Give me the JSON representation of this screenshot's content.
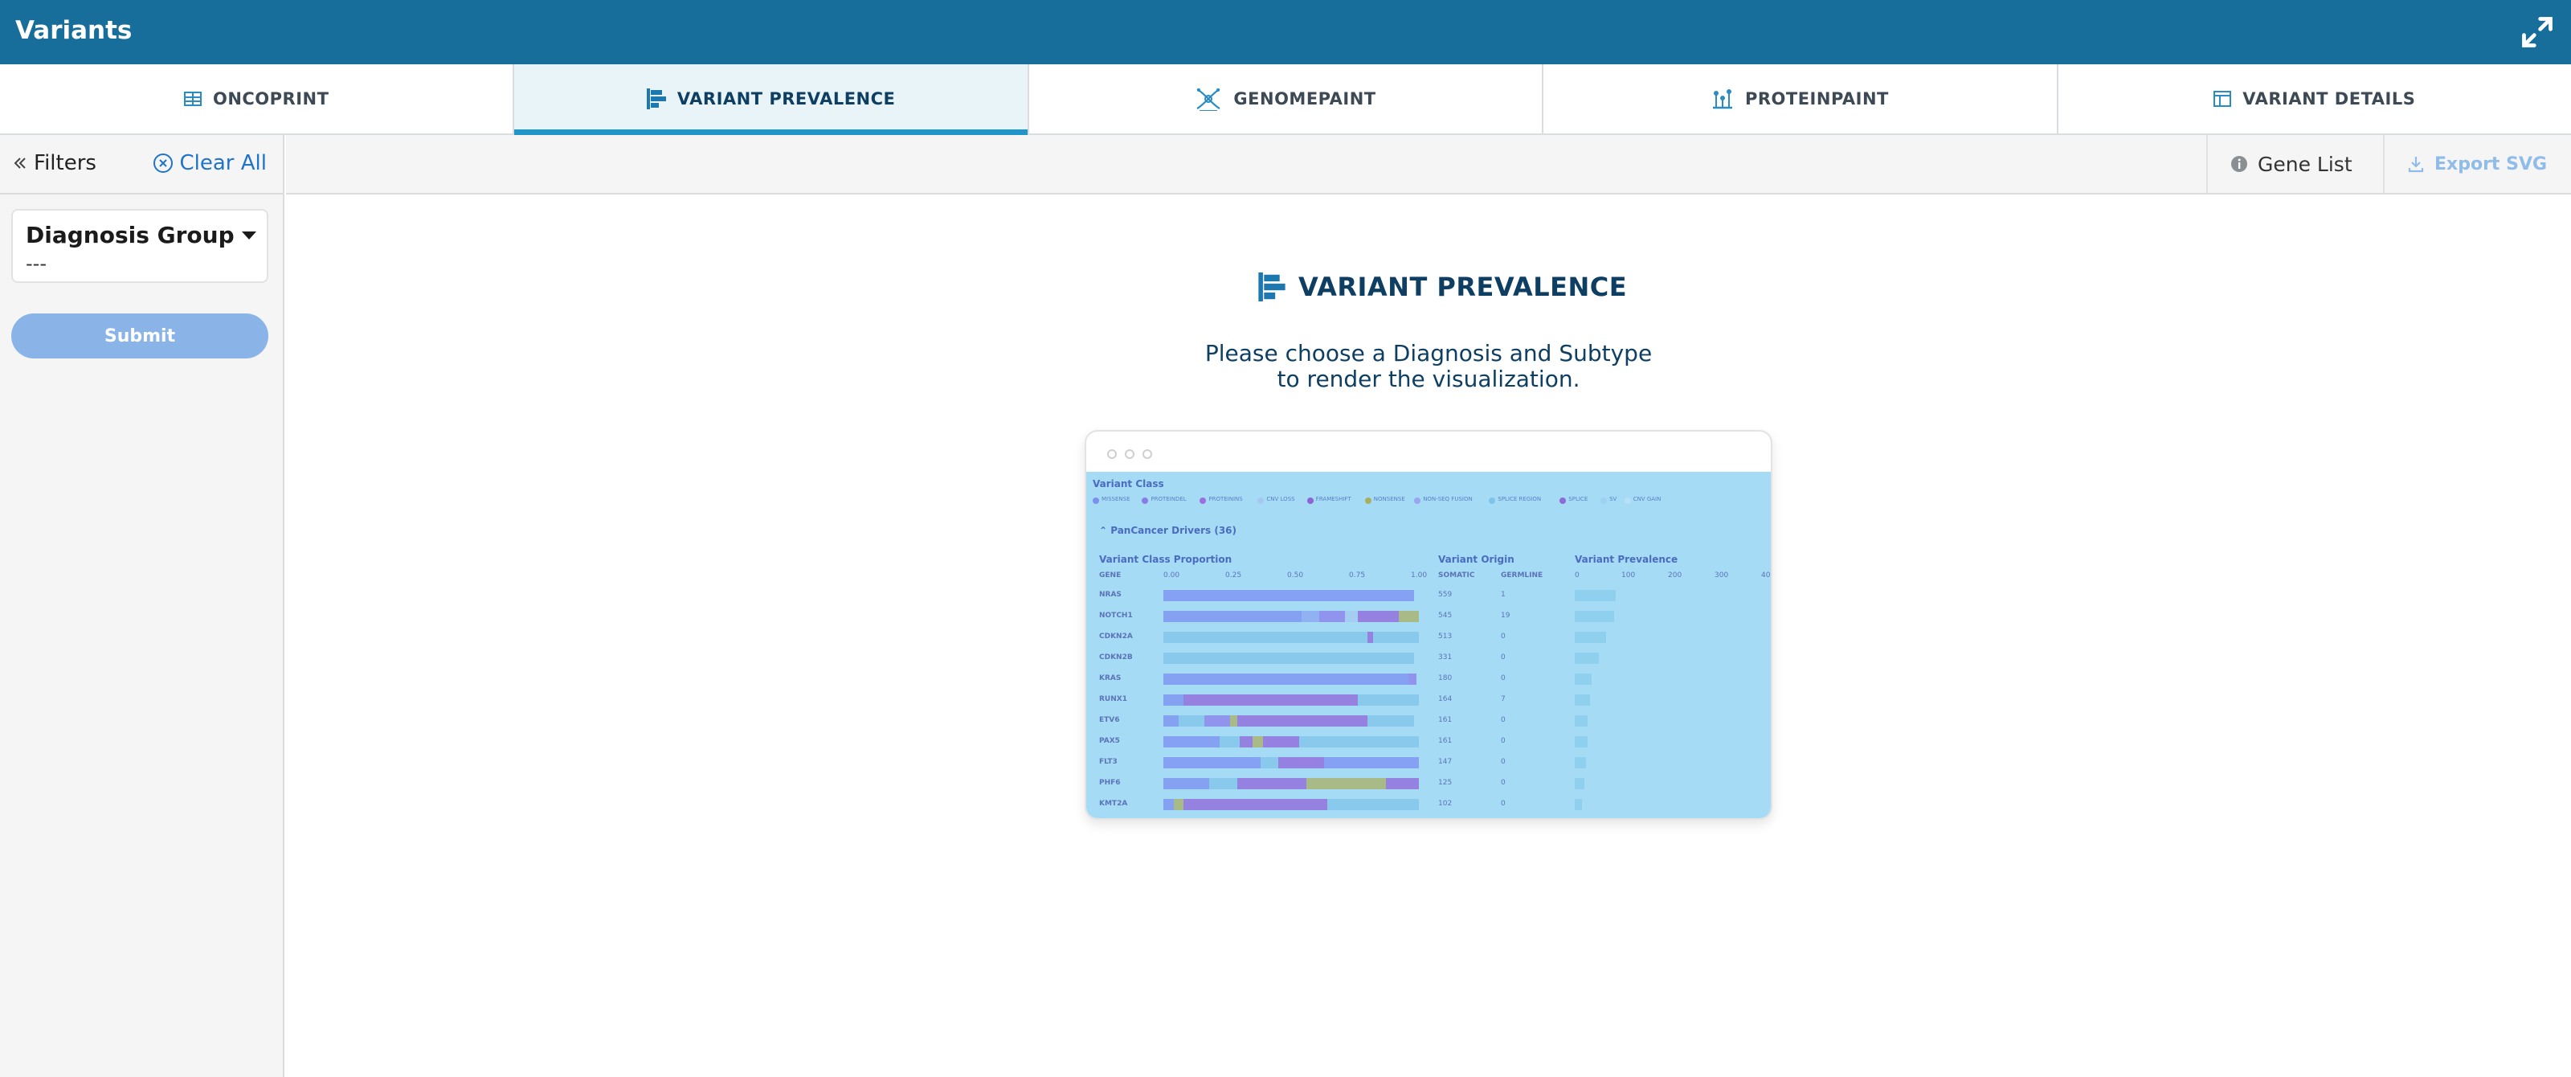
{
  "window": {
    "title": "Variants"
  },
  "tabs": [
    {
      "label": "ONCOPRINT",
      "icon": "table-icon",
      "active": false
    },
    {
      "label": "VARIANT PREVALENCE",
      "icon": "bar-chart-icon",
      "active": true
    },
    {
      "label": "GENOMEPAINT",
      "icon": "genome-icon",
      "active": false
    },
    {
      "label": "PROTEINPAINT",
      "icon": "lollipop-icon",
      "active": false
    },
    {
      "label": "VARIANT DETAILS",
      "icon": "columns-icon",
      "active": false
    }
  ],
  "sidebar": {
    "filters_label": "Filters",
    "clear_all_label": "Clear All",
    "diagnosis_group": {
      "label": "Diagnosis Group",
      "value": "---"
    },
    "submit_label": "Submit"
  },
  "toolbar": {
    "gene_list_label": "Gene List",
    "export_label": "Export SVG"
  },
  "main": {
    "title": "VARIANT PREVALENCE",
    "message_line1": "Please choose a Diagnosis and Subtype",
    "message_line2": "to render the visualization."
  },
  "preview": {
    "variant_class_label": "Variant Class",
    "legend": [
      "MISSENSE",
      "PROTEINDEL",
      "PROTEININS",
      "CNV LOSS",
      "FRAMESHIFT",
      "NONSENSE",
      "NON-SEQ FUSION",
      "SPLICE REGION",
      "SPLICE",
      "SV",
      "CNV GAIN"
    ],
    "group_label": "PanCancer Drivers",
    "group_count": "(36)",
    "headers": {
      "proportion": "Variant Class Proportion",
      "origin": "Variant Origin",
      "prevalence": "Variant Prevalence"
    },
    "subheaders": {
      "gene": "GENE",
      "somatic": "SOMATIC",
      "germline": "GERMLINE"
    },
    "proportion_ticks": [
      "0.00",
      "0.25",
      "0.50",
      "0.75",
      "1.00"
    ],
    "prevalence_ticks": [
      "0",
      "100",
      "200",
      "300",
      "400"
    ],
    "rows": [
      {
        "gene": "NRAS",
        "somatic": "559",
        "germline": "1",
        "prevalence": 0.22
      },
      {
        "gene": "NOTCH1",
        "somatic": "545",
        "germline": "19",
        "prevalence": 0.21
      },
      {
        "gene": "CDKN2A",
        "somatic": "513",
        "germline": "0",
        "prevalence": 0.17
      },
      {
        "gene": "CDKN2B",
        "somatic": "331",
        "germline": "0",
        "prevalence": 0.13
      },
      {
        "gene": "KRAS",
        "somatic": "180",
        "germline": "0",
        "prevalence": 0.09
      },
      {
        "gene": "RUNX1",
        "somatic": "164",
        "germline": "7",
        "prevalence": 0.08
      },
      {
        "gene": "ETV6",
        "somatic": "161",
        "germline": "0",
        "prevalence": 0.07
      },
      {
        "gene": "PAX5",
        "somatic": "161",
        "germline": "0",
        "prevalence": 0.07
      },
      {
        "gene": "FLT3",
        "somatic": "147",
        "germline": "0",
        "prevalence": 0.06
      },
      {
        "gene": "PHF6",
        "somatic": "125",
        "germline": "0",
        "prevalence": 0.05
      },
      {
        "gene": "KMT2A",
        "somatic": "102",
        "germline": "0",
        "prevalence": 0.04
      }
    ]
  }
}
